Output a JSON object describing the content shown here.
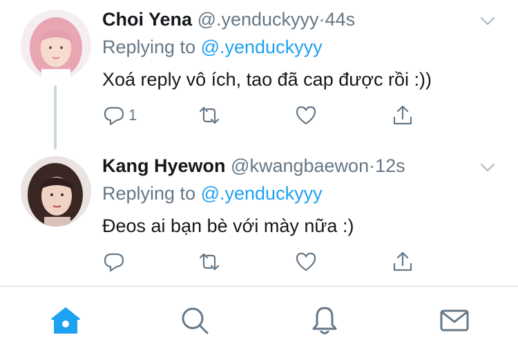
{
  "tweets": [
    {
      "name": "Choi Yena",
      "handle": "@.yenduckyyy",
      "separator": "·",
      "time": "44s",
      "replying_prefix": "Replying to ",
      "replying_handle": "@.yenduckyyy",
      "text": "Xoá reply vô ích, tao đã cap được rồi :))",
      "reply_count": "1",
      "avatar_colors": {
        "hair": "#e8a6b3",
        "skin": "#f6dccf",
        "bg": "#f4eef0"
      }
    },
    {
      "name": "Kang Hyewon",
      "handle": "@kwangbaewon",
      "separator": "·",
      "time": "12s",
      "replying_prefix": "Replying to ",
      "replying_handle": "@.yenduckyyy",
      "text": "Đeos ai bạn bè với mày nữa :)",
      "reply_count": "",
      "avatar_colors": {
        "hair": "#3a2623",
        "skin": "#f1d3c6",
        "bg": "#e9e3e2"
      }
    }
  ],
  "icons": {
    "reply": "reply-icon",
    "retweet": "retweet-icon",
    "like": "heart-icon",
    "share": "share-icon",
    "more": "chevron-down-icon"
  },
  "tabbar": {
    "items": [
      "home-icon",
      "search-icon",
      "notifications-icon",
      "messages-icon"
    ],
    "active": "home-icon"
  },
  "colors": {
    "link": "#1da1f2",
    "muted": "#657786",
    "text": "#14171a",
    "divider": "#cfd6dc"
  }
}
